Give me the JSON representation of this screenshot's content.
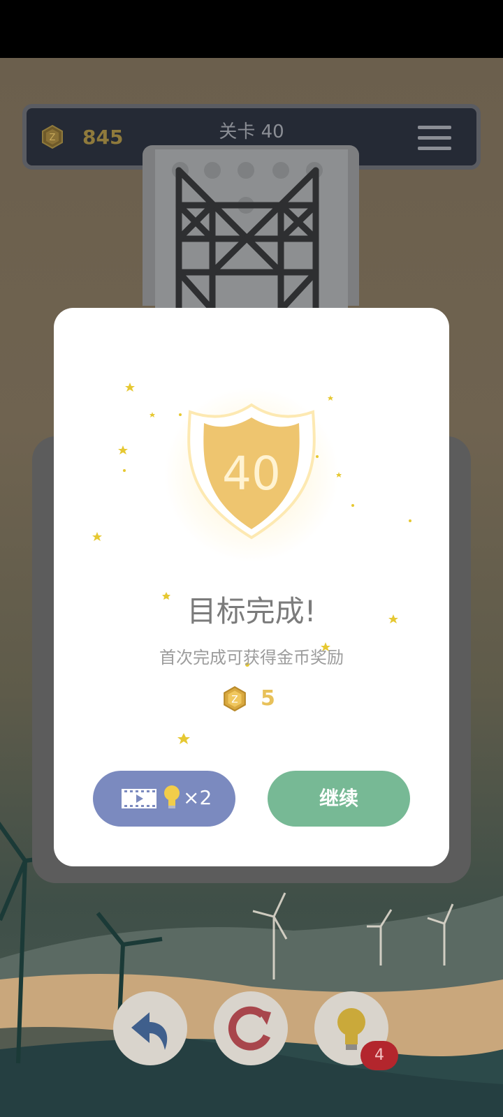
{
  "header": {
    "coins": "845",
    "level_label": "关卡 40"
  },
  "dialog": {
    "badge_level": "40",
    "title": "目标完成!",
    "subtitle": "首次完成可获得金币奖励",
    "reward_amount": "5",
    "video_multiplier": "×2",
    "continue_label": "继续"
  },
  "controls": {
    "hint_count": "4"
  },
  "colors": {
    "accent_gold": "#e8c15a",
    "continue_green": "#77b995",
    "video_blue": "#7b8abf",
    "badge_red": "#b3262d"
  }
}
